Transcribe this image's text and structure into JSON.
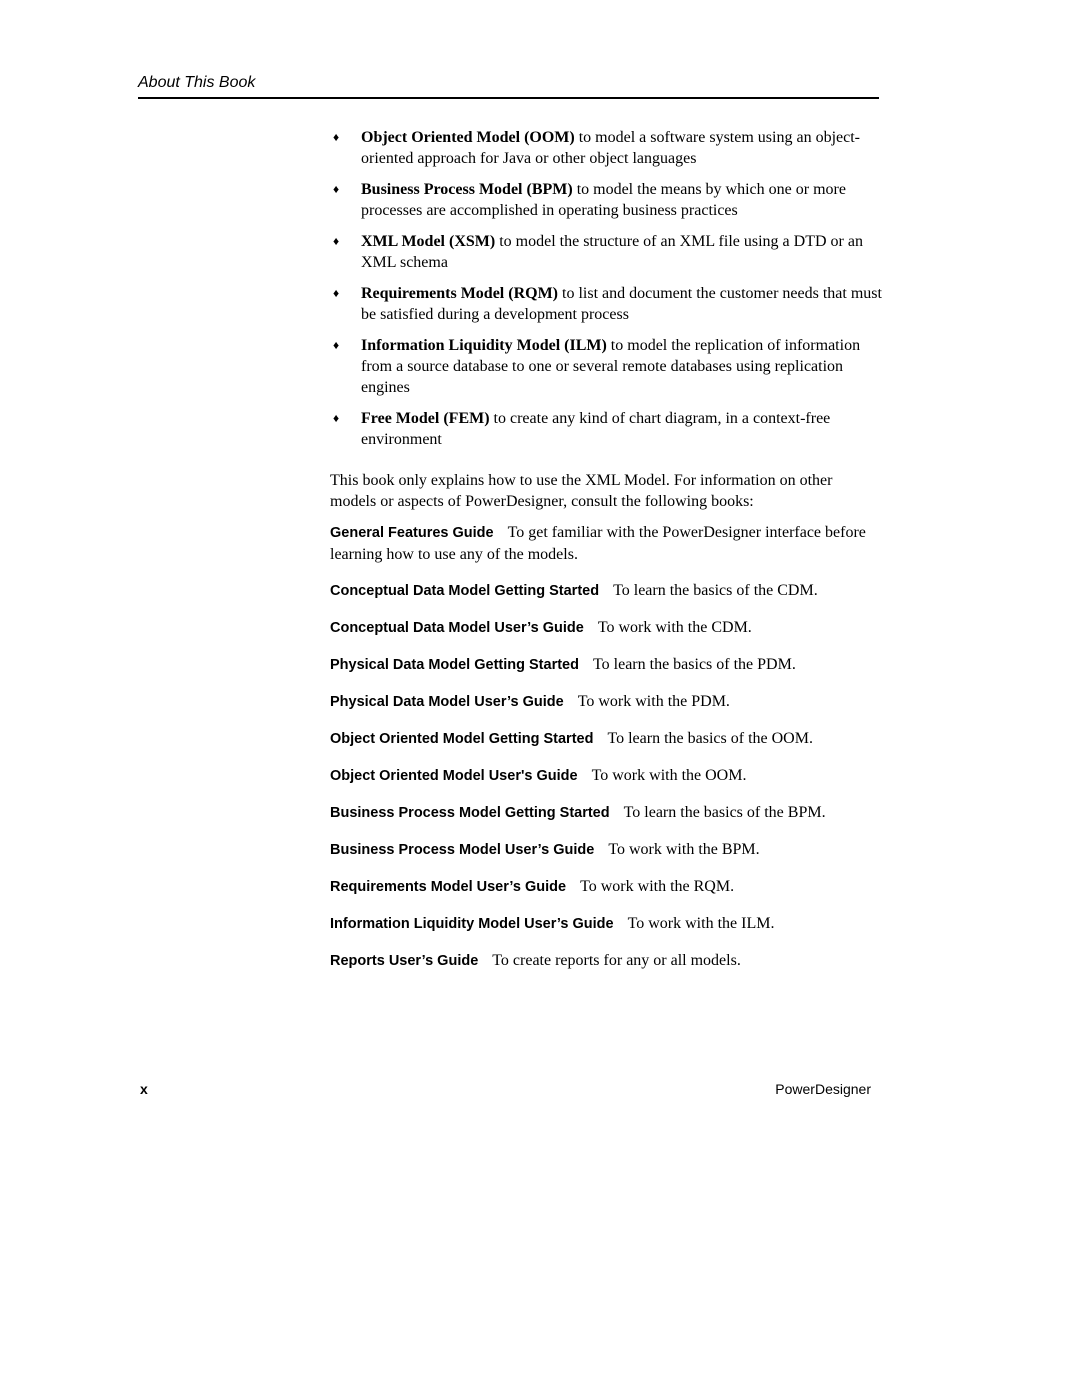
{
  "header": {
    "title": "About This Book"
  },
  "bullets": [
    {
      "icon": "diamond-bullet-icon",
      "glyph": "♦",
      "term": "Object Oriented Model (OOM)",
      "text": " to model a software system using an object-oriented approach for Java or other object languages"
    },
    {
      "icon": "diamond-bullet-icon",
      "glyph": "♦",
      "term": "Business Process Model (BPM)",
      "text": " to model the means by which one or more processes are accomplished in operating business practices"
    },
    {
      "icon": "diamond-bullet-icon",
      "glyph": "♦",
      "term": "XML Model (XSM)",
      "text": " to model the structure of an XML file using a DTD or an XML schema"
    },
    {
      "icon": "diamond-bullet-icon",
      "glyph": "♦",
      "term": "Requirements Model (RQM)",
      "text": " to list and document the customer needs that must be satisfied during a development process"
    },
    {
      "icon": "diamond-bullet-icon",
      "glyph": "♦",
      "term": "Information Liquidity Model (ILM)",
      "text": " to model the replication of information from a source database to one or several remote databases using replication engines"
    },
    {
      "icon": "diamond-bullet-icon",
      "glyph": "♦",
      "term": "Free Model (FEM)",
      "text": " to create any kind of chart diagram, in a context-free environment"
    }
  ],
  "intro": "This book only explains how to use the XML Model. For information on other models or aspects of PowerDesigner, consult the following books:",
  "books": [
    {
      "title": "General Features Guide",
      "desc": "To get familiar with the PowerDesigner interface before learning how to use any of the models."
    },
    {
      "title": "Conceptual Data Model Getting Started",
      "desc": "To learn the basics of the CDM."
    },
    {
      "title": "Conceptual Data Model User’s Guide",
      "desc": "To work with the CDM."
    },
    {
      "title": "Physical Data Model Getting Started",
      "desc": "To learn the basics of the PDM."
    },
    {
      "title": "Physical Data Model User’s Guide",
      "desc": "To work with the PDM."
    },
    {
      "title": "Object Oriented Model Getting Started",
      "desc": "To learn the basics of the OOM."
    },
    {
      "title": "Object Oriented Model User's Guide",
      "desc": "To work with the OOM."
    },
    {
      "title": "Business Process Model Getting Started",
      "desc": "To learn the basics of the BPM."
    },
    {
      "title": "Business Process Model User’s Guide",
      "desc": "To work with the BPM."
    },
    {
      "title": "Requirements Model User’s Guide",
      "desc": "To work with the RQM."
    },
    {
      "title": "Information Liquidity Model User’s Guide",
      "desc": "To work with the ILM."
    },
    {
      "title": "Reports User’s Guide",
      "desc": "To create reports for any or all models."
    }
  ],
  "footer": {
    "page_number": "x",
    "product": "PowerDesigner"
  }
}
